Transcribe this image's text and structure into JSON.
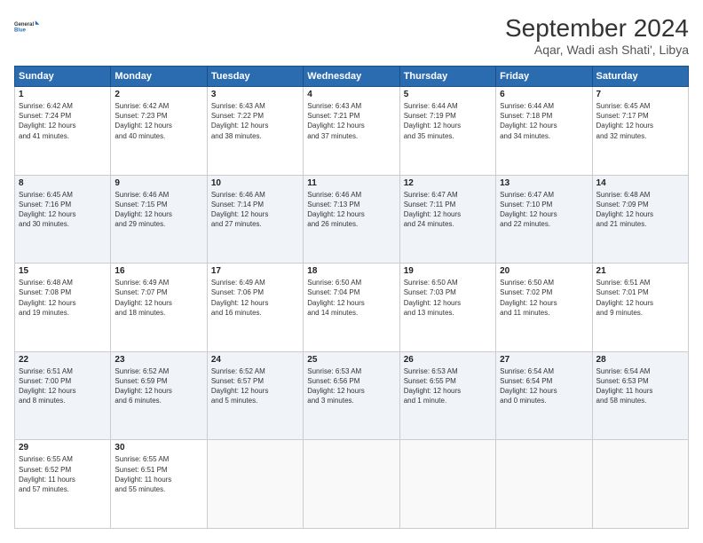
{
  "header": {
    "logo_line1": "General",
    "logo_line2": "Blue",
    "month": "September 2024",
    "location": "Aqar, Wadi ash Shati', Libya"
  },
  "weekdays": [
    "Sunday",
    "Monday",
    "Tuesday",
    "Wednesday",
    "Thursday",
    "Friday",
    "Saturday"
  ],
  "weeks": [
    [
      {
        "day": "1",
        "sunrise": "6:42 AM",
        "sunset": "7:24 PM",
        "daylight": "12 hours and 41 minutes."
      },
      {
        "day": "2",
        "sunrise": "6:42 AM",
        "sunset": "7:23 PM",
        "daylight": "12 hours and 40 minutes."
      },
      {
        "day": "3",
        "sunrise": "6:43 AM",
        "sunset": "7:22 PM",
        "daylight": "12 hours and 38 minutes."
      },
      {
        "day": "4",
        "sunrise": "6:43 AM",
        "sunset": "7:21 PM",
        "daylight": "12 hours and 37 minutes."
      },
      {
        "day": "5",
        "sunrise": "6:44 AM",
        "sunset": "7:19 PM",
        "daylight": "12 hours and 35 minutes."
      },
      {
        "day": "6",
        "sunrise": "6:44 AM",
        "sunset": "7:18 PM",
        "daylight": "12 hours and 34 minutes."
      },
      {
        "day": "7",
        "sunrise": "6:45 AM",
        "sunset": "7:17 PM",
        "daylight": "12 hours and 32 minutes."
      }
    ],
    [
      {
        "day": "8",
        "sunrise": "6:45 AM",
        "sunset": "7:16 PM",
        "daylight": "12 hours and 30 minutes."
      },
      {
        "day": "9",
        "sunrise": "6:46 AM",
        "sunset": "7:15 PM",
        "daylight": "12 hours and 29 minutes."
      },
      {
        "day": "10",
        "sunrise": "6:46 AM",
        "sunset": "7:14 PM",
        "daylight": "12 hours and 27 minutes."
      },
      {
        "day": "11",
        "sunrise": "6:46 AM",
        "sunset": "7:13 PM",
        "daylight": "12 hours and 26 minutes."
      },
      {
        "day": "12",
        "sunrise": "6:47 AM",
        "sunset": "7:11 PM",
        "daylight": "12 hours and 24 minutes."
      },
      {
        "day": "13",
        "sunrise": "6:47 AM",
        "sunset": "7:10 PM",
        "daylight": "12 hours and 22 minutes."
      },
      {
        "day": "14",
        "sunrise": "6:48 AM",
        "sunset": "7:09 PM",
        "daylight": "12 hours and 21 minutes."
      }
    ],
    [
      {
        "day": "15",
        "sunrise": "6:48 AM",
        "sunset": "7:08 PM",
        "daylight": "12 hours and 19 minutes."
      },
      {
        "day": "16",
        "sunrise": "6:49 AM",
        "sunset": "7:07 PM",
        "daylight": "12 hours and 18 minutes."
      },
      {
        "day": "17",
        "sunrise": "6:49 AM",
        "sunset": "7:06 PM",
        "daylight": "12 hours and 16 minutes."
      },
      {
        "day": "18",
        "sunrise": "6:50 AM",
        "sunset": "7:04 PM",
        "daylight": "12 hours and 14 minutes."
      },
      {
        "day": "19",
        "sunrise": "6:50 AM",
        "sunset": "7:03 PM",
        "daylight": "12 hours and 13 minutes."
      },
      {
        "day": "20",
        "sunrise": "6:50 AM",
        "sunset": "7:02 PM",
        "daylight": "12 hours and 11 minutes."
      },
      {
        "day": "21",
        "sunrise": "6:51 AM",
        "sunset": "7:01 PM",
        "daylight": "12 hours and 9 minutes."
      }
    ],
    [
      {
        "day": "22",
        "sunrise": "6:51 AM",
        "sunset": "7:00 PM",
        "daylight": "12 hours and 8 minutes."
      },
      {
        "day": "23",
        "sunrise": "6:52 AM",
        "sunset": "6:59 PM",
        "daylight": "12 hours and 6 minutes."
      },
      {
        "day": "24",
        "sunrise": "6:52 AM",
        "sunset": "6:57 PM",
        "daylight": "12 hours and 5 minutes."
      },
      {
        "day": "25",
        "sunrise": "6:53 AM",
        "sunset": "6:56 PM",
        "daylight": "12 hours and 3 minutes."
      },
      {
        "day": "26",
        "sunrise": "6:53 AM",
        "sunset": "6:55 PM",
        "daylight": "12 hours and 1 minute."
      },
      {
        "day": "27",
        "sunrise": "6:54 AM",
        "sunset": "6:54 PM",
        "daylight": "12 hours and 0 minutes."
      },
      {
        "day": "28",
        "sunrise": "6:54 AM",
        "sunset": "6:53 PM",
        "daylight": "11 hours and 58 minutes."
      }
    ],
    [
      {
        "day": "29",
        "sunrise": "6:55 AM",
        "sunset": "6:52 PM",
        "daylight": "11 hours and 57 minutes."
      },
      {
        "day": "30",
        "sunrise": "6:55 AM",
        "sunset": "6:51 PM",
        "daylight": "11 hours and 55 minutes."
      },
      null,
      null,
      null,
      null,
      null
    ]
  ]
}
